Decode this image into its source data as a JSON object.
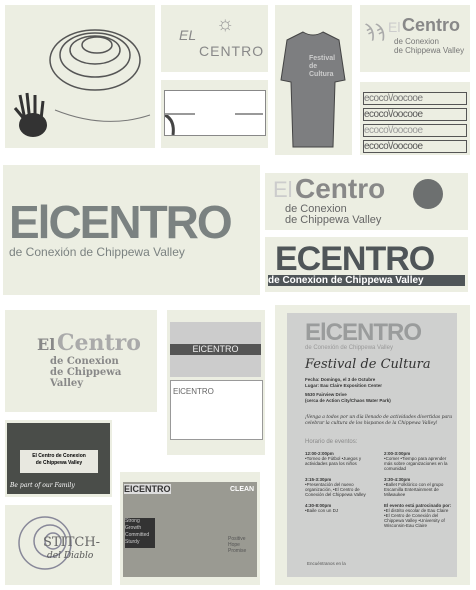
{
  "logo": {
    "el": "El",
    "centro": "Centro",
    "el_caps": "EL",
    "centro_caps": "CENTRO",
    "full": "ElCENTRO",
    "full_short": "ECENTRO",
    "sub1": "de Conexion",
    "sub2": "de Chippewa Valley",
    "sub_accent": "de Conexión   de Chippewa Valley",
    "sub_line": "de Conexion  de Chippewa Valley"
  },
  "sketch": {
    "el": "EL",
    "centro": "CENTRO"
  },
  "tshirt": {
    "line1": "Festival",
    "line2": "de",
    "line3": "Cultura"
  },
  "pattern": {
    "rows": [
      "ecoco\\/oocooe",
      "ecoco\\/oocooe",
      "ecoco\\/oocooe",
      "ecoco\\/oocooe"
    ]
  },
  "letterhead": {
    "title": "ElCENTRO"
  },
  "photo": {
    "banner1": "El Centro de Conexion",
    "banner2": "de Chippewa Valley",
    "caption": "Be part of our Family"
  },
  "stitch": {
    "title": "STITCH-",
    "sub": "del Diablo"
  },
  "collage": {
    "logo": "ElCENTRO",
    "clean": "CLEAN",
    "words": [
      "Strong",
      "Growth",
      "Committed",
      "Sturdy"
    ],
    "hope": [
      "Positive",
      "Hope",
      "Promise"
    ]
  },
  "poster": {
    "title": "Festival de Cultura",
    "fecha": "Fecha: Domingo, el 3 de Octubre",
    "lugar": "Lugar: Eau Claire Exposition Center",
    "addr1": "5530 Fairview Drive",
    "addr2": "(cerca de Action City/Chaos Water Park)",
    "invite": "¡Venga a todos por un día llenado de actividades divertidas para celebrar la cultura de los hispanos de la Chippewa Valley!",
    "horario": "Horario de eventos:",
    "events": [
      {
        "time": "12:00-2:00pm",
        "items": "•Torneo de Fútbol •Juegos y actividades para los niños"
      },
      {
        "time": "2:00-3:00pm",
        "items": "•Comer •Tiempo para aprender más sobre organizaciones en la comunidad"
      },
      {
        "time": "3:15-3:30pm",
        "items": "•Presentación del nuevo organización, •El Centro de Conexión del Chippewa Valley"
      },
      {
        "time": "3:30-4:30pm",
        "items": "•Ballet Folklórico con el grupo Escamilla Entertainment de Milwaukee"
      },
      {
        "time": "4:30-8:00pm",
        "items": "•Baile con un DJ"
      },
      {
        "time": "El evento está patrocinado por:",
        "items": "•El distrito escolar de Eau Claire •El Centro de Conexión del Chippewa Valley •University of Wisconsin-Eau Claire"
      }
    ],
    "footer": "Encuéntranos en la"
  }
}
